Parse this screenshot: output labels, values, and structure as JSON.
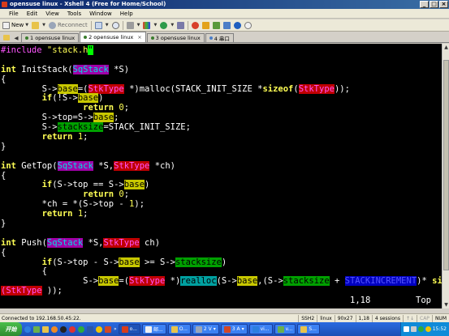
{
  "window": {
    "title": "opensuse linux - Xshell 4 (Free for Home/School)",
    "controls": {
      "minimize": "_",
      "maximize": "□",
      "close": "×"
    }
  },
  "menu": [
    "File",
    "Edit",
    "View",
    "Tools",
    "Window",
    "Help"
  ],
  "toolbar": {
    "new_label": "New",
    "reconnect_label": "Reconnect",
    "icons": [
      "new-session-icon",
      "open-folder-icon",
      "reconnect-icon",
      "properties-icon",
      "zoom-icon",
      "print-icon",
      "color-scheme-icon",
      "transfer-icon",
      "script-icon",
      "xftp-icon",
      "lock-icon",
      "compose-icon",
      "help-icon"
    ]
  },
  "tabs": [
    {
      "label": "1 opensuse linux",
      "active": false
    },
    {
      "label": "2 opensuse linux",
      "active": true
    },
    {
      "label": "3 opensuse linux",
      "active": false
    },
    {
      "label": "4 串口",
      "active": false
    }
  ],
  "terminal": {
    "lines": [
      [
        {
          "t": "#include ",
          "c": "pp"
        },
        {
          "t": "\"stack.h",
          "c": "str"
        },
        {
          "t": "\"",
          "c": "cursor"
        }
      ],
      [],
      [
        {
          "t": "int ",
          "c": "kw"
        },
        {
          "t": "InitStack("
        },
        {
          "t": "SqStack",
          "c": "hl-pur"
        },
        {
          "t": " *S)"
        }
      ],
      [
        {
          "t": "{"
        }
      ],
      [
        {
          "t": "        S->"
        },
        {
          "t": "base",
          "c": "hl-yel"
        },
        {
          "t": "=("
        },
        {
          "t": "StkType",
          "c": "hl-red"
        },
        {
          "t": " *)malloc(STACK_INIT_SIZE *"
        },
        {
          "t": "sizeof",
          "c": "kw"
        },
        {
          "t": "("
        },
        {
          "t": "StkType",
          "c": "hl-red"
        },
        {
          "t": "));"
        }
      ],
      [
        {
          "t": "        "
        },
        {
          "t": "if",
          "c": "kw"
        },
        {
          "t": "(!S->"
        },
        {
          "t": "base",
          "c": "hl-yel"
        },
        {
          "t": ")"
        }
      ],
      [
        {
          "t": "                "
        },
        {
          "t": "return ",
          "c": "kw"
        },
        {
          "t": "0",
          "c": "num"
        },
        {
          "t": ";"
        }
      ],
      [
        {
          "t": "        S->top=S->"
        },
        {
          "t": "base",
          "c": "hl-yel"
        },
        {
          "t": ";"
        }
      ],
      [
        {
          "t": "        S->"
        },
        {
          "t": "stacksize",
          "c": "hl-grn"
        },
        {
          "t": "=STACK_INIT_SIZE;"
        }
      ],
      [
        {
          "t": "        "
        },
        {
          "t": "return ",
          "c": "kw"
        },
        {
          "t": "1",
          "c": "num"
        },
        {
          "t": ";"
        }
      ],
      [
        {
          "t": "}"
        }
      ],
      [],
      [
        {
          "t": "int ",
          "c": "kw"
        },
        {
          "t": "GetTop("
        },
        {
          "t": "SqStack",
          "c": "hl-pur"
        },
        {
          "t": " *S,"
        },
        {
          "t": "StkType",
          "c": "hl-red"
        },
        {
          "t": " *ch)"
        }
      ],
      [
        {
          "t": "{"
        }
      ],
      [
        {
          "t": "        "
        },
        {
          "t": "if",
          "c": "kw"
        },
        {
          "t": "(S->top == S->"
        },
        {
          "t": "base",
          "c": "hl-yel"
        },
        {
          "t": ")"
        }
      ],
      [
        {
          "t": "                "
        },
        {
          "t": "return ",
          "c": "kw"
        },
        {
          "t": "0",
          "c": "num"
        },
        {
          "t": ";"
        }
      ],
      [
        {
          "t": "        *ch = *(S->top - "
        },
        {
          "t": "1",
          "c": "num"
        },
        {
          "t": ");"
        }
      ],
      [
        {
          "t": "        "
        },
        {
          "t": "return ",
          "c": "kw"
        },
        {
          "t": "1",
          "c": "num"
        },
        {
          "t": ";"
        }
      ],
      [
        {
          "t": "}"
        }
      ],
      [],
      [
        {
          "t": "int ",
          "c": "kw"
        },
        {
          "t": "Push("
        },
        {
          "t": "SqStack",
          "c": "hl-pur"
        },
        {
          "t": " *S,"
        },
        {
          "t": "StkType",
          "c": "hl-red"
        },
        {
          "t": " ch)"
        }
      ],
      [
        {
          "t": "{"
        }
      ],
      [
        {
          "t": "        "
        },
        {
          "t": "if",
          "c": "kw"
        },
        {
          "t": "(S->top - S->"
        },
        {
          "t": "base",
          "c": "hl-yel"
        },
        {
          "t": " >= S->"
        },
        {
          "t": "stacksize",
          "c": "hl-grn"
        },
        {
          "t": ")"
        }
      ],
      [
        {
          "t": "        {"
        }
      ],
      [
        {
          "t": "                S->"
        },
        {
          "t": "base",
          "c": "hl-yel"
        },
        {
          "t": "=("
        },
        {
          "t": "StkType",
          "c": "hl-red"
        },
        {
          "t": " *)"
        },
        {
          "t": "realloc",
          "c": "hl-cyn"
        },
        {
          "t": "(S->"
        },
        {
          "t": "base",
          "c": "hl-yel"
        },
        {
          "t": ",(S->"
        },
        {
          "t": "stacksize",
          "c": "hl-grn"
        },
        {
          "t": " + "
        },
        {
          "t": "STACKINCREMENT",
          "c": "hl-blu"
        },
        {
          "t": ")* "
        },
        {
          "t": "sizeof",
          "c": "kw"
        }
      ],
      [
        {
          "t": "(",
          "c": "hl-red"
        },
        {
          "t": "StkType",
          "c": "hl-red"
        },
        {
          "t": " ));"
        }
      ]
    ],
    "ruler": {
      "position": "1,18",
      "scroll": "Top"
    }
  },
  "status": {
    "connection": "Connected to 192.168.50.45:22.",
    "protocol": "SSH2",
    "terminal_type": "linux",
    "size": "90x27",
    "cursor": "1,18",
    "sessions": "4 sessions",
    "caps": "CAP",
    "num": "NUM"
  },
  "taskbar": {
    "start_label": "开始",
    "tasks": [
      {
        "label": "o...",
        "active": true
      },
      {
        "label": "邮...",
        "active": false
      },
      {
        "label": "O...",
        "active": false
      },
      {
        "label": "2 V",
        "active": false
      },
      {
        "label": "3 A",
        "active": false
      },
      {
        "label": "vi...",
        "active": false
      },
      {
        "label": "v...",
        "active": false
      },
      {
        "label": "S...",
        "active": false
      }
    ],
    "clock": "15:52"
  }
}
